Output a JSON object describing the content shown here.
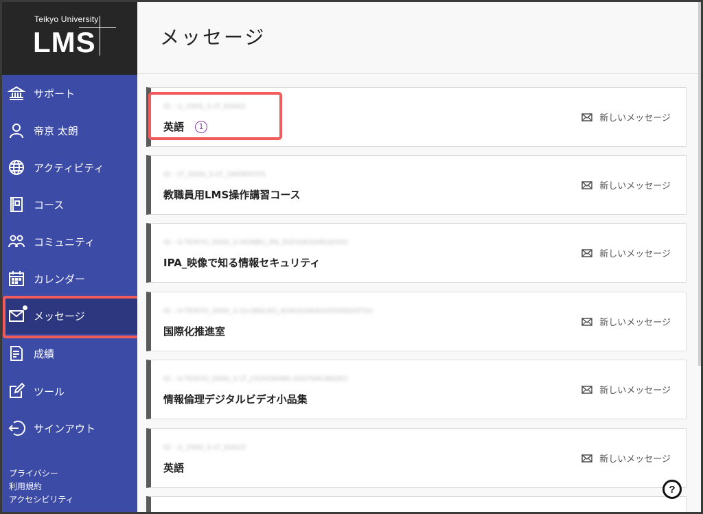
{
  "brand": {
    "university": "Teikyo University",
    "product": "LMS"
  },
  "sidebar": {
    "items": [
      {
        "label": "サポート",
        "icon": "bank-icon"
      },
      {
        "label": "帝京 太朗",
        "icon": "user-icon"
      },
      {
        "label": "アクティビティ",
        "icon": "globe-icon"
      },
      {
        "label": "コース",
        "icon": "book-icon"
      },
      {
        "label": "コミュニティ",
        "icon": "people-icon"
      },
      {
        "label": "カレンダー",
        "icon": "calendar-icon"
      },
      {
        "label": "メッセージ",
        "icon": "envelope-icon",
        "active": true
      },
      {
        "label": "成績",
        "icon": "grades-icon"
      },
      {
        "label": "ツール",
        "icon": "edit-icon"
      },
      {
        "label": "サインアウト",
        "icon": "signout-icon"
      }
    ],
    "footer": [
      "プライバシー",
      "利用規約",
      "アクセシビリティ"
    ]
  },
  "page": {
    "title": "メッセージ"
  },
  "courses": [
    {
      "code": "ID : U_2000_S-LT_E0A01",
      "name": "英語",
      "unread": "1",
      "action": "新しいメッセージ"
    },
    {
      "code": "ID : LT_0000_S-LT_1W0W0Y0S",
      "name": "教職員用LMS操作講習コース",
      "action": "新しいメッセージ"
    },
    {
      "code": "ID : G-TEIKYO_0000_S-HONBU_IPA_EIZODESHIRUJOHO",
      "name": "IPA_映像で知る情報セキュリティ",
      "action": "新しいメッセージ"
    },
    {
      "code": "ID : G-TEIKYO_0000_S-GLOBALKO_KOKUSAIKASUISHINSHITSU",
      "name": "国際化推進室",
      "action": "新しいメッセージ"
    },
    {
      "code": "ID : G-TEIKYO_0000_S-LT_JYOHORINRI-DIGITARUBIDEO",
      "name": "情報倫理デジタルビデオ小品集",
      "action": "新しいメッセージ"
    },
    {
      "code": "ID : U_2000_S-LT_E0A22",
      "name": "英語",
      "action": "新しいメッセージ"
    }
  ],
  "help": {
    "label": "?"
  }
}
